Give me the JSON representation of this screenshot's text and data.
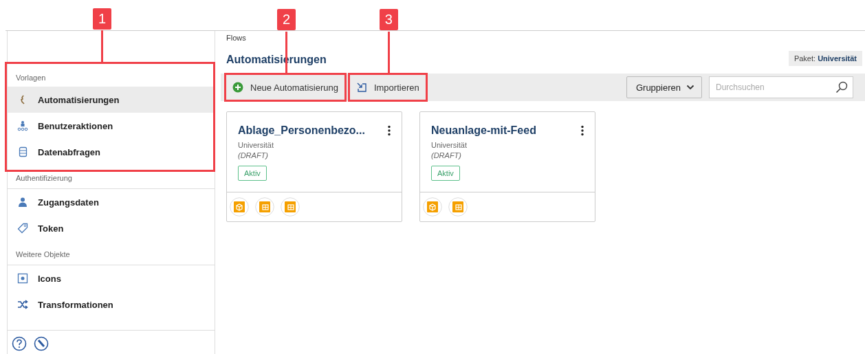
{
  "sidebar": {
    "sections": [
      {
        "title": "Vorlagen",
        "callout": "1",
        "items": [
          {
            "label": "Automatisierungen",
            "selected": true
          },
          {
            "label": "Benutzeraktionen",
            "selected": false
          },
          {
            "label": "Datenabfragen",
            "selected": false
          }
        ]
      },
      {
        "title": "Authentifizierung",
        "items": [
          {
            "label": "Zugangsdaten",
            "selected": false
          },
          {
            "label": "Token",
            "selected": false
          }
        ]
      },
      {
        "title": "Weitere Objekte",
        "items": [
          {
            "label": "Icons",
            "selected": false
          },
          {
            "label": "Transformationen",
            "selected": false
          }
        ]
      }
    ]
  },
  "breadcrumb": "Flows",
  "title": "Automatisierungen",
  "package": {
    "label": "Paket:",
    "value": "Universität"
  },
  "toolbar": {
    "buttons": [
      {
        "label": "Neue Automatisierung",
        "callout": "2"
      },
      {
        "label": "Importieren",
        "callout": "3"
      }
    ],
    "group_button": "Gruppieren",
    "search": {
      "placeholder": "Durchsuchen"
    }
  },
  "cards": [
    {
      "title": "Ablage_Personenbezo...",
      "package": "Universität",
      "status": "(DRAFT)",
      "badge": "Aktiv",
      "items": [
        {
          "kind": "box"
        },
        {
          "kind": "table"
        },
        {
          "kind": "table"
        }
      ]
    },
    {
      "title": "Neuanlage-mit-Feed",
      "package": "Universität",
      "status": "(DRAFT)",
      "badge": "Aktiv",
      "items": [
        {
          "kind": "box"
        },
        {
          "kind": "table"
        }
      ]
    }
  ]
}
